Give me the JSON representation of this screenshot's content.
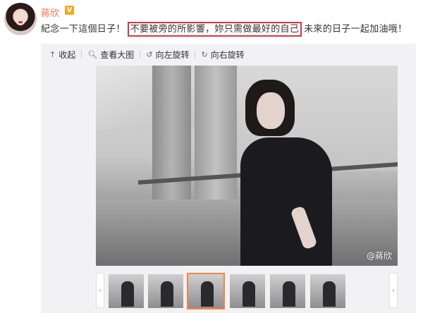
{
  "user": {
    "name": "蔣欣",
    "verified_badge": "V"
  },
  "post": {
    "text_before": "紀念一下這個日子！",
    "text_highlight": "不要被旁的所影響，妳只需做最好的自己",
    "text_after": "未來的日子一起加油哦！"
  },
  "toolbar": {
    "collapse_label": "收起",
    "collapse_icon": "arrow-up-icon",
    "view_large_label": "查看大图",
    "view_large_icon": "search-icon",
    "rotate_left_label": "向左旋转",
    "rotate_left_icon": "rotate-left-icon",
    "rotate_right_label": "向右旋转",
    "rotate_right_icon": "rotate-right-icon"
  },
  "photo": {
    "watermark": "@蔣欣"
  },
  "thumbnails": {
    "count": 6,
    "active_index": 2
  },
  "colors": {
    "name": "#eb7350",
    "highlight_border": "#d9363e",
    "active_thumb_border": "#ff8140"
  }
}
